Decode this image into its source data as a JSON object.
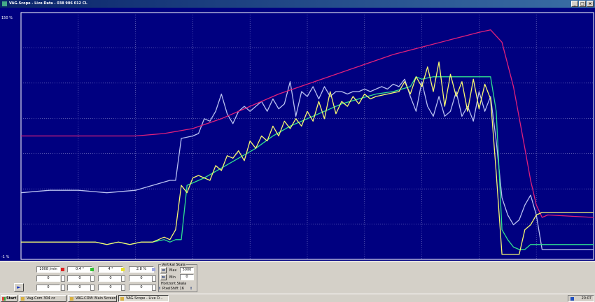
{
  "window": {
    "title": "VAG-Scope  -  Live Data  -  038 906 012 CL",
    "buttons": [
      "_",
      "□",
      "×"
    ]
  },
  "plot": {
    "y_top_label": "150 %",
    "y_bottom_label": "-1 %",
    "colors": {
      "background": "#000080",
      "grid": "#8080d0",
      "frame": "#ffffff",
      "rpm": "#e0207a",
      "yellow": "#f8f870",
      "green": "#30e090",
      "lavender": "#b8c0f0"
    }
  },
  "chart_data": {
    "type": "line",
    "x_range": [
      0,
      100
    ],
    "y_range": [
      0,
      100
    ],
    "grid": true,
    "series": [
      {
        "channel": "rpm",
        "color": "#e0207a",
        "values": [
          [
            0,
            50
          ],
          [
            20,
            50
          ],
          [
            25,
            51
          ],
          [
            30,
            53
          ],
          [
            35,
            57
          ],
          [
            40,
            62
          ],
          [
            45,
            67
          ],
          [
            50,
            71
          ],
          [
            55,
            75
          ],
          [
            60,
            79
          ],
          [
            65,
            83
          ],
          [
            70,
            86
          ],
          [
            75,
            89
          ],
          [
            80,
            92
          ],
          [
            82,
            93
          ],
          [
            84,
            88
          ],
          [
            86,
            70
          ],
          [
            88,
            45
          ],
          [
            89,
            32
          ],
          [
            90,
            22
          ],
          [
            91,
            17
          ],
          [
            92,
            18
          ],
          [
            100,
            17
          ]
        ]
      },
      {
        "channel": "yellow",
        "values": [
          [
            0,
            7
          ],
          [
            13,
            7
          ],
          [
            15,
            6
          ],
          [
            17,
            7
          ],
          [
            19,
            6
          ],
          [
            21,
            7
          ],
          [
            23,
            7
          ],
          [
            25,
            9
          ],
          [
            26,
            8
          ],
          [
            27,
            12
          ],
          [
            28,
            30
          ],
          [
            29,
            27
          ],
          [
            30,
            33
          ],
          [
            31,
            34
          ],
          [
            33,
            32
          ],
          [
            34,
            38
          ],
          [
            35,
            36
          ],
          [
            36,
            42
          ],
          [
            37,
            41
          ],
          [
            38,
            44
          ],
          [
            39,
            40
          ],
          [
            40,
            48
          ],
          [
            41,
            45
          ],
          [
            42,
            50
          ],
          [
            43,
            48
          ],
          [
            44,
            54
          ],
          [
            45,
            50
          ],
          [
            46,
            56
          ],
          [
            47,
            53
          ],
          [
            48,
            57
          ],
          [
            49,
            54
          ],
          [
            50,
            60
          ],
          [
            51,
            56
          ],
          [
            52,
            64
          ],
          [
            53,
            57
          ],
          [
            54,
            68
          ],
          [
            55,
            59
          ],
          [
            56,
            64
          ],
          [
            57,
            62
          ],
          [
            58,
            66
          ],
          [
            59,
            63
          ],
          [
            60,
            67
          ],
          [
            61,
            65
          ],
          [
            62,
            66
          ],
          [
            64,
            67
          ],
          [
            66,
            68
          ],
          [
            67,
            72
          ],
          [
            68,
            67
          ],
          [
            69,
            74
          ],
          [
            70,
            70
          ],
          [
            71,
            78
          ],
          [
            72,
            68
          ],
          [
            73,
            80
          ],
          [
            74,
            62
          ],
          [
            75,
            75
          ],
          [
            76,
            66
          ],
          [
            77,
            72
          ],
          [
            78,
            60
          ],
          [
            79,
            73
          ],
          [
            80,
            61
          ],
          [
            81,
            71
          ],
          [
            82,
            65
          ],
          [
            83,
            35
          ],
          [
            84,
            2
          ],
          [
            85,
            2
          ],
          [
            86,
            2
          ],
          [
            87,
            2
          ],
          [
            88,
            12
          ],
          [
            89,
            14
          ],
          [
            90,
            18
          ],
          [
            91,
            19
          ],
          [
            100,
            19
          ]
        ]
      },
      {
        "channel": "green",
        "values": [
          [
            0,
            7
          ],
          [
            13,
            7
          ],
          [
            15,
            6
          ],
          [
            17,
            7
          ],
          [
            19,
            6
          ],
          [
            21,
            7
          ],
          [
            23,
            7
          ],
          [
            25,
            8
          ],
          [
            26,
            7
          ],
          [
            27,
            8
          ],
          [
            28,
            8
          ],
          [
            29,
            30
          ],
          [
            30,
            31
          ],
          [
            32,
            33
          ],
          [
            35,
            37
          ],
          [
            38,
            41
          ],
          [
            41,
            45
          ],
          [
            44,
            50
          ],
          [
            47,
            54
          ],
          [
            50,
            57
          ],
          [
            53,
            60
          ],
          [
            56,
            63
          ],
          [
            59,
            65
          ],
          [
            62,
            67
          ],
          [
            65,
            68
          ],
          [
            68,
            70
          ],
          [
            69,
            74
          ],
          [
            70,
            73
          ],
          [
            72,
            74
          ],
          [
            80,
            74
          ],
          [
            81,
            74
          ],
          [
            82,
            74
          ],
          [
            83,
            60
          ],
          [
            84,
            12
          ],
          [
            85,
            8
          ],
          [
            86,
            5
          ],
          [
            87,
            4
          ],
          [
            88,
            4
          ],
          [
            89,
            6
          ],
          [
            100,
            6
          ]
        ]
      },
      {
        "channel": "lavender",
        "values": [
          [
            0,
            27
          ],
          [
            5,
            28
          ],
          [
            10,
            28
          ],
          [
            15,
            27
          ],
          [
            20,
            28
          ],
          [
            23,
            30
          ],
          [
            26,
            32
          ],
          [
            27,
            32
          ],
          [
            28,
            49
          ],
          [
            30,
            50
          ],
          [
            31,
            51
          ],
          [
            32,
            57
          ],
          [
            33,
            56
          ],
          [
            34,
            60
          ],
          [
            35,
            67
          ],
          [
            36,
            59
          ],
          [
            37,
            55
          ],
          [
            38,
            60
          ],
          [
            39,
            62
          ],
          [
            40,
            60
          ],
          [
            41,
            62
          ],
          [
            42,
            64
          ],
          [
            43,
            60
          ],
          [
            44,
            65
          ],
          [
            45,
            61
          ],
          [
            46,
            63
          ],
          [
            47,
            72
          ],
          [
            48,
            58
          ],
          [
            49,
            68
          ],
          [
            50,
            66
          ],
          [
            51,
            70
          ],
          [
            52,
            65
          ],
          [
            53,
            70
          ],
          [
            54,
            66
          ],
          [
            55,
            68
          ],
          [
            56,
            68
          ],
          [
            57,
            67
          ],
          [
            58,
            68
          ],
          [
            59,
            68
          ],
          [
            60,
            69
          ],
          [
            61,
            68
          ],
          [
            62,
            69
          ],
          [
            63,
            70
          ],
          [
            64,
            69
          ],
          [
            65,
            71
          ],
          [
            66,
            70
          ],
          [
            67,
            73
          ],
          [
            68,
            66
          ],
          [
            69,
            60
          ],
          [
            70,
            72
          ],
          [
            71,
            62
          ],
          [
            72,
            58
          ],
          [
            73,
            66
          ],
          [
            74,
            58
          ],
          [
            75,
            60
          ],
          [
            76,
            68
          ],
          [
            77,
            58
          ],
          [
            78,
            62
          ],
          [
            79,
            56
          ],
          [
            80,
            68
          ],
          [
            81,
            60
          ],
          [
            82,
            66
          ],
          [
            83,
            48
          ],
          [
            84,
            25
          ],
          [
            85,
            18
          ],
          [
            86,
            14
          ],
          [
            87,
            16
          ],
          [
            88,
            22
          ],
          [
            89,
            26
          ],
          [
            90,
            18
          ],
          [
            91,
            4
          ],
          [
            100,
            4
          ]
        ]
      }
    ]
  },
  "controls": {
    "row1": [
      "1008 /min",
      "0.4 °",
      "4 °",
      "2.8 %"
    ],
    "row2": [
      "0",
      "0",
      "0",
      "0"
    ],
    "row3": [
      "0",
      "0",
      "0",
      "0"
    ],
    "channel_colors": [
      "#e02020",
      "#30c030",
      "#e8e030",
      "#a0a8e0"
    ],
    "vertical_scale": {
      "title": "Vertikal Skala",
      "max_label": "Max",
      "max_value": "5000",
      "min_label": "Min",
      "min_value": "0"
    },
    "horizontal_scale": {
      "title": "Horizont.Skala",
      "value": "PixelShift 16"
    },
    "play_symbol": "►"
  },
  "taskbar": {
    "start_label": "Start",
    "tasks": [
      "Vag-Com 304 cz",
      "VAG-COM: Main Screen",
      "VAG-Scope  -  Live D..."
    ],
    "active_index": 2,
    "clock": "20:07"
  }
}
